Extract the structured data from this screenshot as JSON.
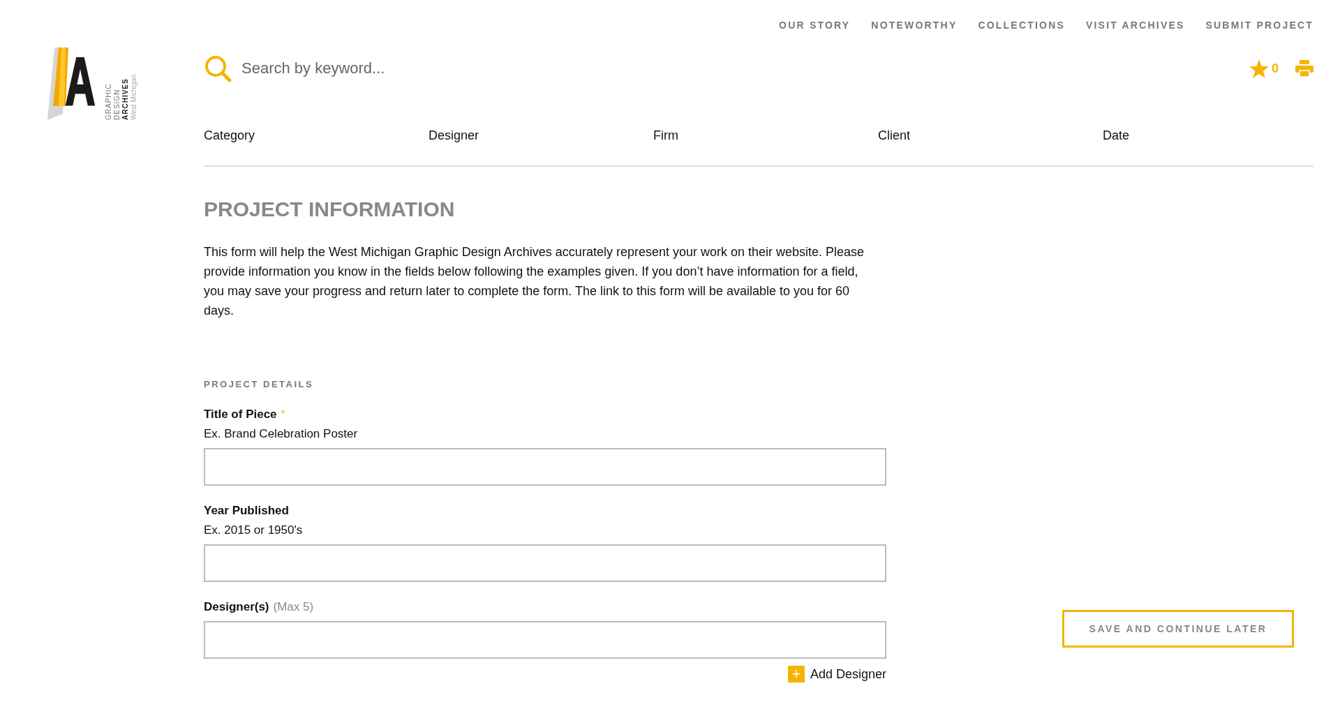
{
  "logo": {
    "mark": "A",
    "lines": [
      "GRAPHIC",
      "DESIGN",
      "ARCHIVES",
      "West Michigan"
    ]
  },
  "nav": [
    "OUR STORY",
    "NOTEWORTHY",
    "COLLECTIONS",
    "VISIT ARCHIVES",
    "SUBMIT PROJECT"
  ],
  "search": {
    "placeholder": "Search by keyword..."
  },
  "favorites": {
    "count": "0"
  },
  "filters": [
    "Category",
    "Designer",
    "Firm",
    "Client",
    "Date"
  ],
  "heading": "PROJECT INFORMATION",
  "intro": "This form will help the West Michigan Graphic Design Archives accurately represent your work on their website. Please provide information you know in the fields below following the examples given. If you don’t have information for a field, you may save your progress and return later to complete the form. The link to this form will be available to you for 60 days.",
  "section": "PROJECT DETAILS",
  "required_mark": "*",
  "fields": [
    {
      "label": "Title of Piece",
      "required": true,
      "hint": "Ex. Brand Celebration Poster"
    },
    {
      "label": "Year Published",
      "required": false,
      "hint": "Ex. 2015 or 1950's"
    },
    {
      "label": "Designer(s)",
      "required": false,
      "note": "(Max 5)"
    }
  ],
  "add_button": {
    "icon": "+",
    "label": "Add Designer"
  },
  "save_button": "SAVE AND CONTINUE LATER"
}
